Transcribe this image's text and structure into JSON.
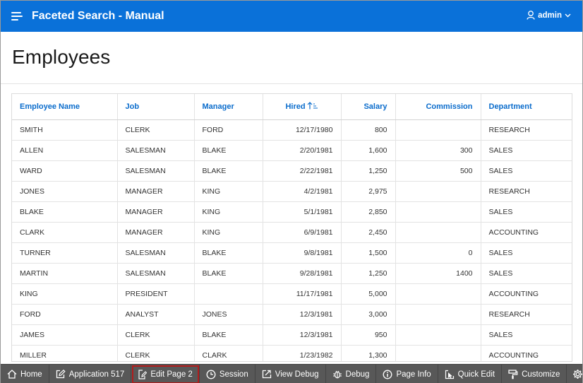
{
  "header": {
    "app_title": "Faceted Search - Manual",
    "user": "admin"
  },
  "page": {
    "title": "Employees"
  },
  "report": {
    "columns": [
      {
        "label": "Employee Name",
        "align": "left"
      },
      {
        "label": "Job",
        "align": "left"
      },
      {
        "label": "Manager",
        "align": "left"
      },
      {
        "label": "Hired",
        "align": "center",
        "sorted": "ascending"
      },
      {
        "label": "Salary",
        "align": "right"
      },
      {
        "label": "Commission",
        "align": "right"
      },
      {
        "label": "Department",
        "align": "left"
      }
    ],
    "rows": [
      [
        "SMITH",
        "CLERK",
        "FORD",
        "12/17/1980",
        "800",
        "",
        "RESEARCH"
      ],
      [
        "ALLEN",
        "SALESMAN",
        "BLAKE",
        "2/20/1981",
        "1,600",
        "300",
        "SALES"
      ],
      [
        "WARD",
        "SALESMAN",
        "BLAKE",
        "2/22/1981",
        "1,250",
        "500",
        "SALES"
      ],
      [
        "JONES",
        "MANAGER",
        "KING",
        "4/2/1981",
        "2,975",
        "",
        "RESEARCH"
      ],
      [
        "BLAKE",
        "MANAGER",
        "KING",
        "5/1/1981",
        "2,850",
        "",
        "SALES"
      ],
      [
        "CLARK",
        "MANAGER",
        "KING",
        "6/9/1981",
        "2,450",
        "",
        "ACCOUNTING"
      ],
      [
        "TURNER",
        "SALESMAN",
        "BLAKE",
        "9/8/1981",
        "1,500",
        "0",
        "SALES"
      ],
      [
        "MARTIN",
        "SALESMAN",
        "BLAKE",
        "9/28/1981",
        "1,250",
        "1400",
        "SALES"
      ],
      [
        "KING",
        "PRESIDENT",
        "",
        "11/17/1981",
        "5,000",
        "",
        "ACCOUNTING"
      ],
      [
        "FORD",
        "ANALYST",
        "JONES",
        "12/3/1981",
        "3,000",
        "",
        "RESEARCH"
      ],
      [
        "JAMES",
        "CLERK",
        "BLAKE",
        "12/3/1981",
        "950",
        "",
        "SALES"
      ],
      [
        "MILLER",
        "CLERK",
        "CLARK",
        "1/23/1982",
        "1,300",
        "",
        "ACCOUNTING"
      ]
    ]
  },
  "devbar": {
    "home": "Home",
    "application": "Application 517",
    "edit_page": "Edit Page 2",
    "session": "Session",
    "view_debug": "View Debug",
    "debug": "Debug",
    "page_info": "Page Info",
    "quick_edit": "Quick Edit",
    "customize": "Customize"
  },
  "colors": {
    "header_bg": "#0a71d9",
    "link": "#0a6ccc",
    "devbar_bg": "#585858",
    "active_outline": "#b01c1c"
  }
}
